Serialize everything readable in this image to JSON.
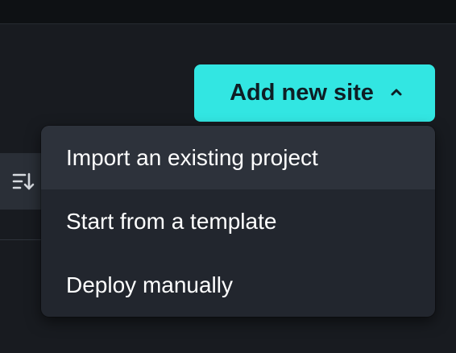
{
  "header": {
    "add_site_label": "Add new site",
    "add_site_icon": "chevron-up-icon",
    "accent_color": "#32e6e2"
  },
  "toolbar": {
    "sort_icon": "sort-descending-icon"
  },
  "dropdown": {
    "items": [
      {
        "label": "Import an existing project",
        "highlighted": true
      },
      {
        "label": "Start from a template",
        "highlighted": false
      },
      {
        "label": "Deploy manually",
        "highlighted": false
      }
    ]
  }
}
